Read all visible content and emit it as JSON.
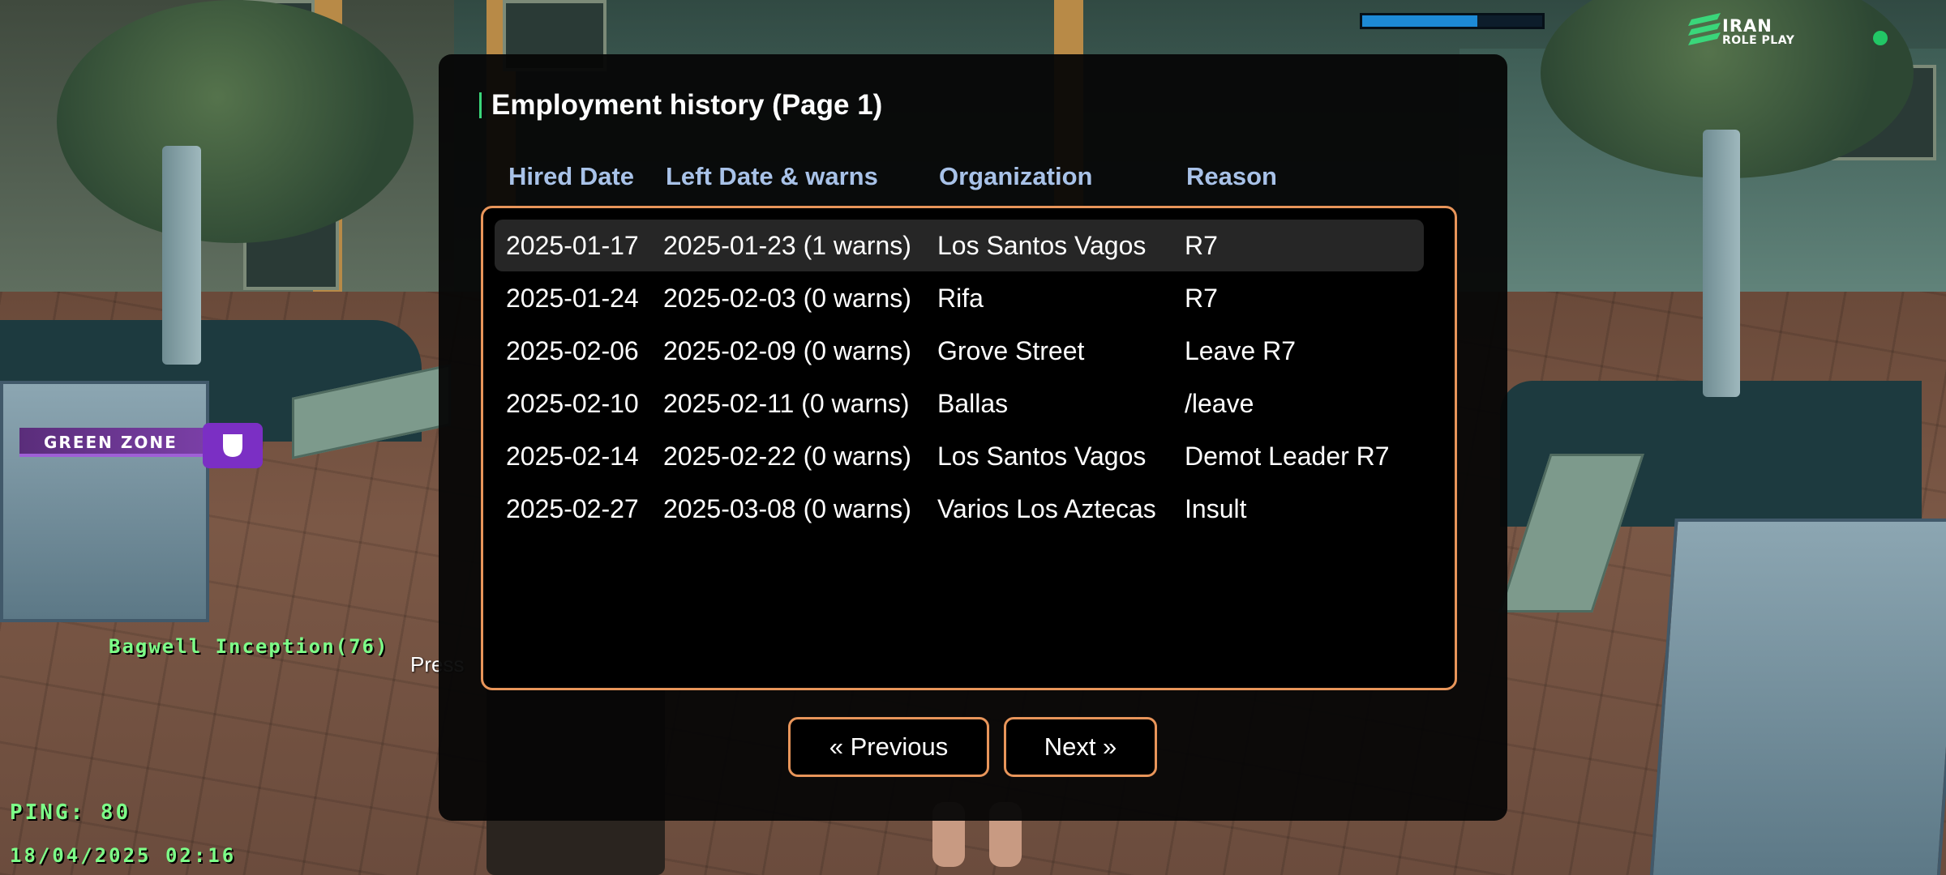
{
  "hud": {
    "health_bar_fill": 0.64,
    "logo_line1": "IRAN",
    "logo_line2": "ROLE PLAY",
    "zone_label": "GREEN ZONE",
    "player_name": "Bagwell Inception(76)",
    "press_hint": "Press",
    "ping": "PING: 80",
    "datetime": "18/04/2025 02:16"
  },
  "dialog": {
    "title": "Employment history (Page 1)",
    "columns": [
      "Hired Date",
      "Left Date & warns",
      "Organization",
      "Reason"
    ],
    "rows": [
      {
        "hired": "2025-01-17",
        "left": "2025-01-23 (1 warns)",
        "organization": "Los Santos Vagos",
        "reason": "R7"
      },
      {
        "hired": "2025-01-24",
        "left": "2025-02-03 (0 warns)",
        "organization": "Rifa",
        "reason": "R7"
      },
      {
        "hired": "2025-02-06",
        "left": "2025-02-09 (0 warns)",
        "organization": "Grove Street",
        "reason": "Leave R7"
      },
      {
        "hired": "2025-02-10",
        "left": "2025-02-11 (0 warns)",
        "organization": "Ballas",
        "reason": "/leave"
      },
      {
        "hired": "2025-02-14",
        "left": "2025-02-22 (0 warns)",
        "organization": "Los Santos Vagos",
        "reason": "Demot Leader R7"
      },
      {
        "hired": "2025-02-27",
        "left": "2025-03-08 (0 warns)",
        "organization": "Varios Los Aztecas",
        "reason": "Insult"
      }
    ],
    "selected_row": 0,
    "prev_label": "« Previous",
    "next_label": "Next »"
  },
  "colors": {
    "accent_border": "#e8955a",
    "header_text": "#a8c2e8",
    "hud_green": "#7dff88",
    "zone_purple": "#7b2fc4"
  }
}
